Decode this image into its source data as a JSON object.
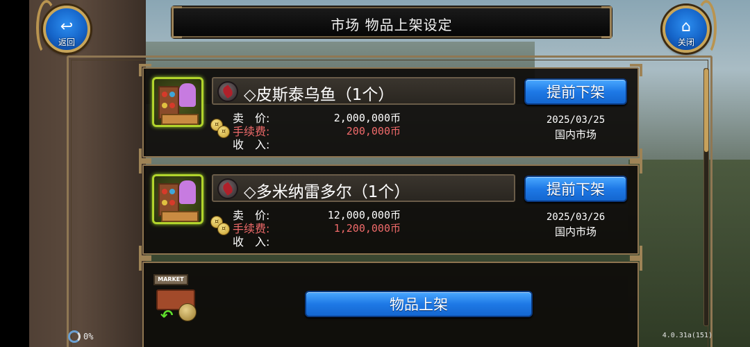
{
  "header": {
    "title": "市场  物品上架设定",
    "back_label": "返回",
    "close_label": "关闭",
    "back_icon": "back-arrow-icon",
    "close_icon": "home-icon"
  },
  "labels": {
    "price": "卖　价:",
    "fee": "手续费:",
    "income": "收　入:"
  },
  "listings": [
    {
      "name": "◇皮斯泰乌鱼（1个）",
      "price": "2,000,000币",
      "fee": "200,000币",
      "income": "",
      "date": "2025/03/25",
      "market": "国内市场",
      "button": "提前下架"
    },
    {
      "name": "◇多米纳雷多尔（1个）",
      "price": "12,000,000币",
      "fee": "1,200,000币",
      "income": "",
      "date": "2025/03/26",
      "market": "国内市场",
      "button": "提前下架"
    }
  ],
  "add_panel": {
    "button": "物品上架",
    "market_sign": "MARKET"
  },
  "footer": {
    "loading": "0%",
    "version": "4.0.31a(151)"
  },
  "colors": {
    "button_blue": "#1e79e6",
    "fee_red": "#f06a6a",
    "gold_border": "#8e7550"
  }
}
